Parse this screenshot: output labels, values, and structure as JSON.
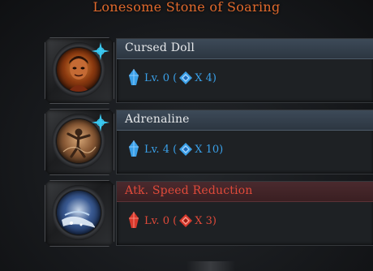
{
  "title": "Lonesome Stone of Soaring",
  "colors": {
    "title": "#e0692c",
    "blue": "#3aa0e8",
    "red": "#e04a3a",
    "star": "#3ac8f0"
  },
  "items": [
    {
      "name": "Cursed Doll",
      "icon": "cursed-doll-portrait-icon",
      "marked": true,
      "state": "blue",
      "level_label": "Lv. 0 (",
      "count_label": "X 4)"
    },
    {
      "name": "Adrenaline",
      "icon": "adrenaline-dancer-icon",
      "marked": true,
      "state": "blue",
      "level_label": "Lv. 4 (",
      "count_label": "X 10)"
    },
    {
      "name": "Atk. Speed Reduction",
      "icon": "atk-speed-reduction-icon",
      "marked": false,
      "state": "red",
      "level_label": "Lv. 0 (",
      "count_label": "X 3)"
    }
  ]
}
